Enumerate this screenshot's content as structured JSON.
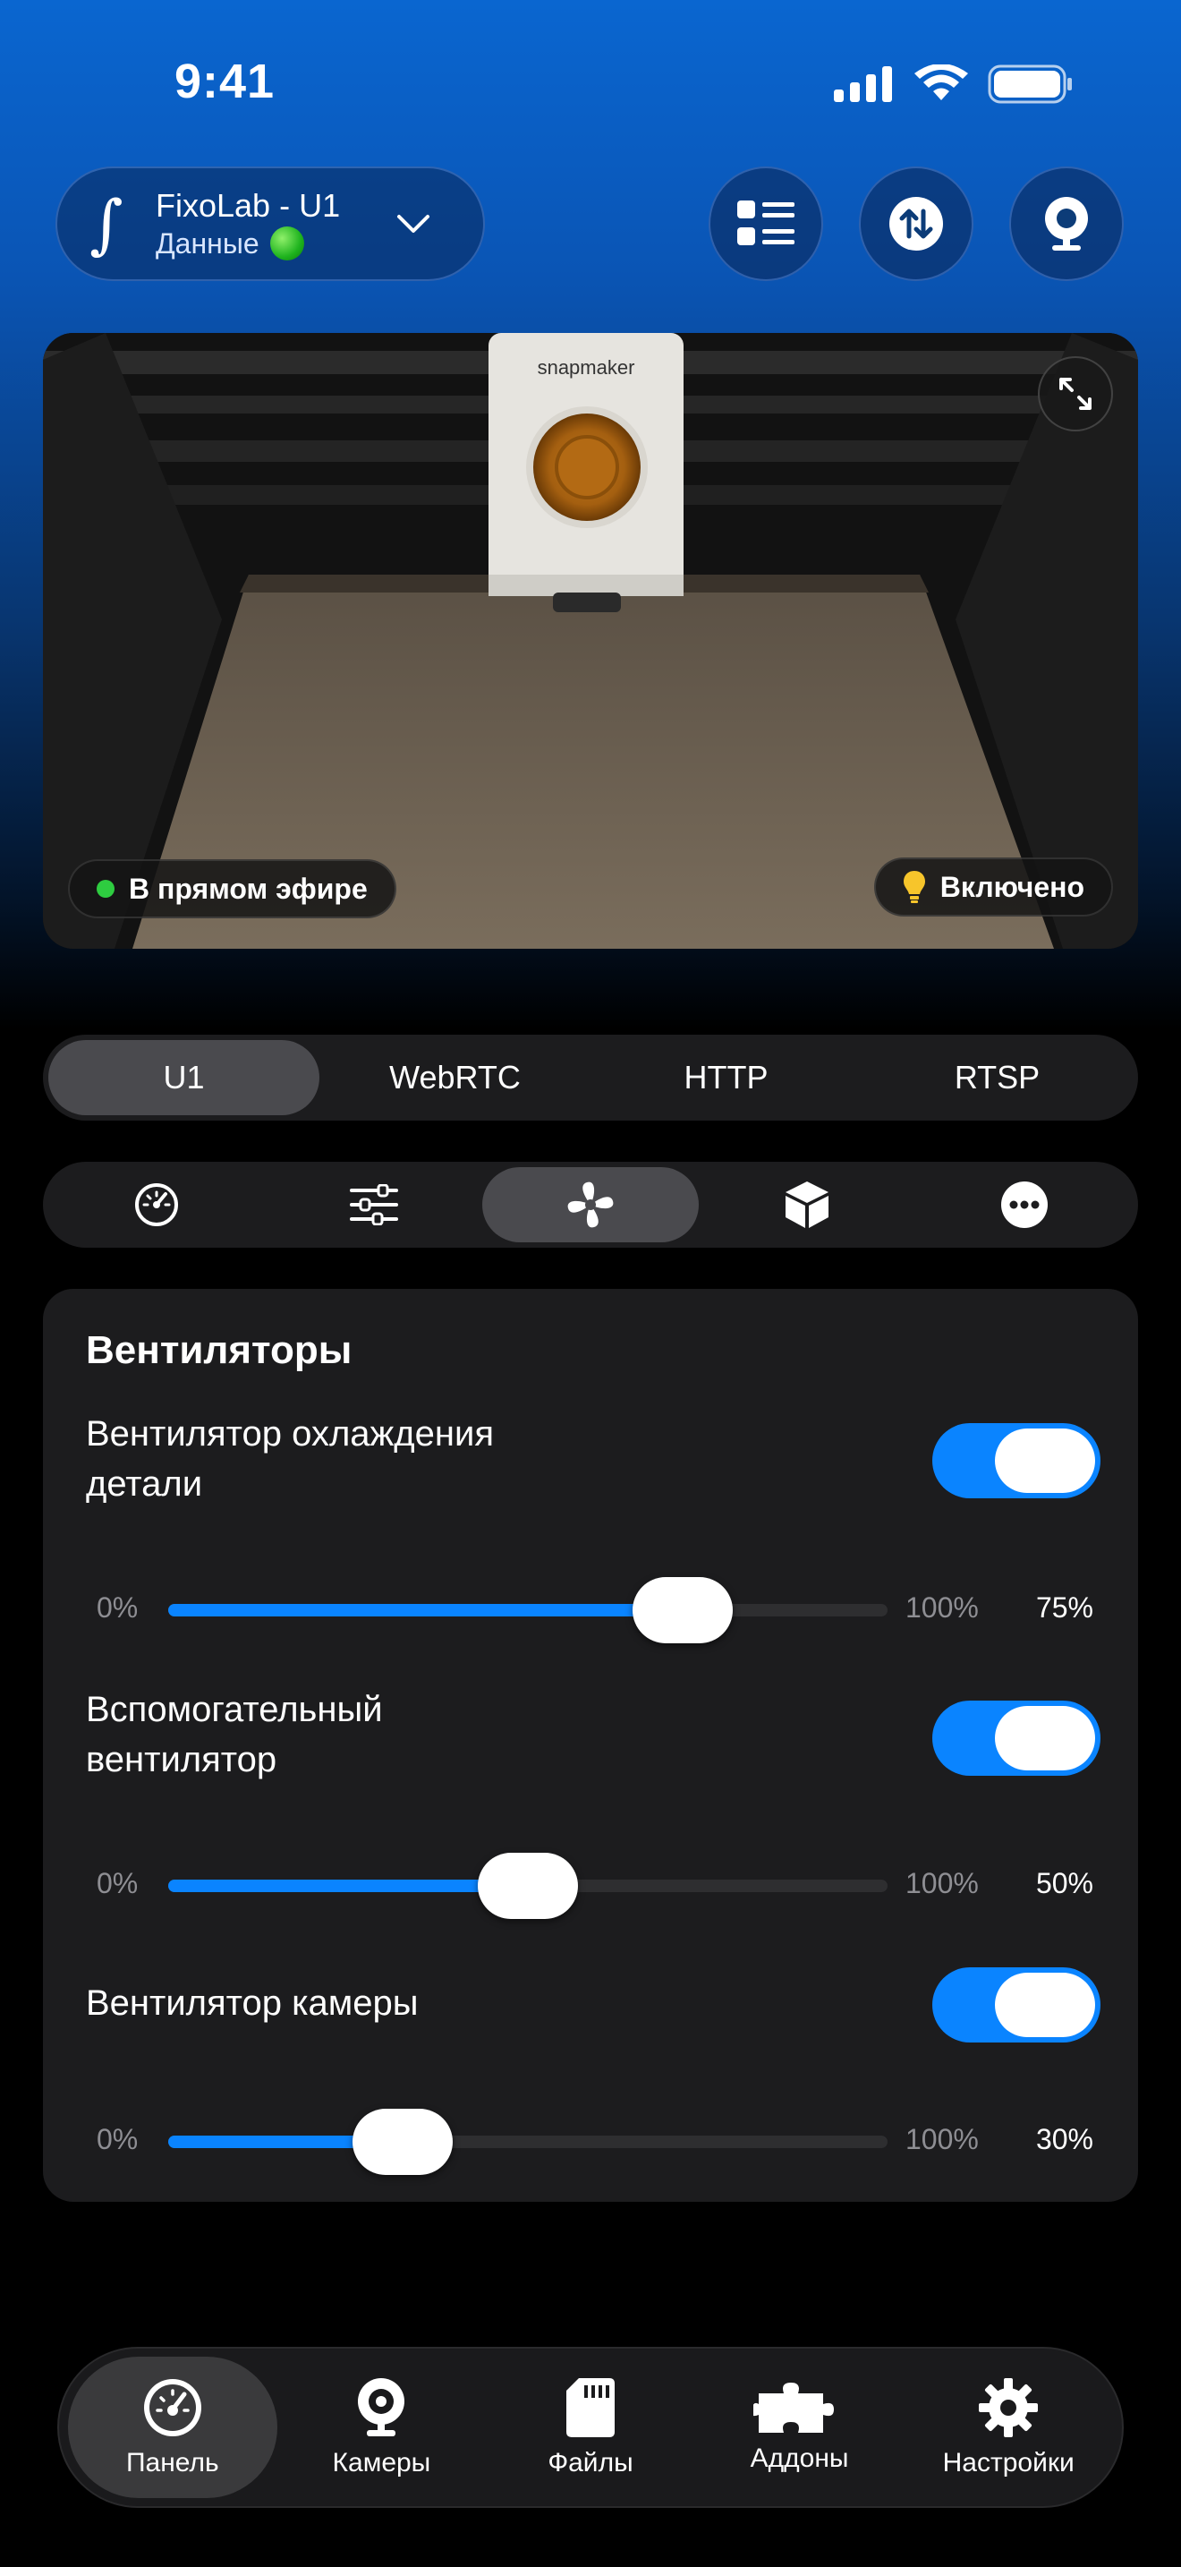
{
  "status_bar": {
    "time": "9:41"
  },
  "device": {
    "name": "FixoLab - U1",
    "subtitle": "Данные"
  },
  "camera": {
    "brand": "snapmaker",
    "live_label": "В прямом эфире",
    "light_label": "Включено"
  },
  "stream_tabs": [
    {
      "label": "U1",
      "active": true
    },
    {
      "label": "WebRTC",
      "active": false
    },
    {
      "label": "HTTP",
      "active": false
    },
    {
      "label": "RTSP",
      "active": false
    }
  ],
  "panel_tabs": [
    "gauge-icon",
    "sliders-icon",
    "fan-icon",
    "cube-icon",
    "more-icon"
  ],
  "panel_tabs_active": "fan-icon",
  "fans": {
    "title": "Вентиляторы",
    "items": [
      {
        "name_line1": "Вентилятор охлаждения",
        "name_line2": "детали",
        "enabled": true,
        "min": "0%",
        "max": "100%",
        "value_label": "75%",
        "value": 0.75
      },
      {
        "name_line1": "Вспомогательный",
        "name_line2": "вентилятор",
        "enabled": true,
        "min": "0%",
        "max": "100%",
        "value_label": "50%",
        "value": 0.5
      },
      {
        "name_line1": "Вентилятор камеры",
        "name_line2": "",
        "enabled": true,
        "min": "0%",
        "max": "100%",
        "value_label": "30%",
        "value": 0.3
      }
    ]
  },
  "bottom_nav": [
    {
      "label": "Панель",
      "icon": "dashboard-icon",
      "active": true
    },
    {
      "label": "Камеры",
      "icon": "webcam-icon",
      "active": false
    },
    {
      "label": "Файлы",
      "icon": "sd-card-icon",
      "active": false
    },
    {
      "label": "Аддоны",
      "icon": "puzzle-icon",
      "active": false
    },
    {
      "label": "Настройки",
      "icon": "gear-icon",
      "active": false
    }
  ],
  "colors": {
    "accent": "#0a84ff",
    "live": "#2ecc40"
  }
}
